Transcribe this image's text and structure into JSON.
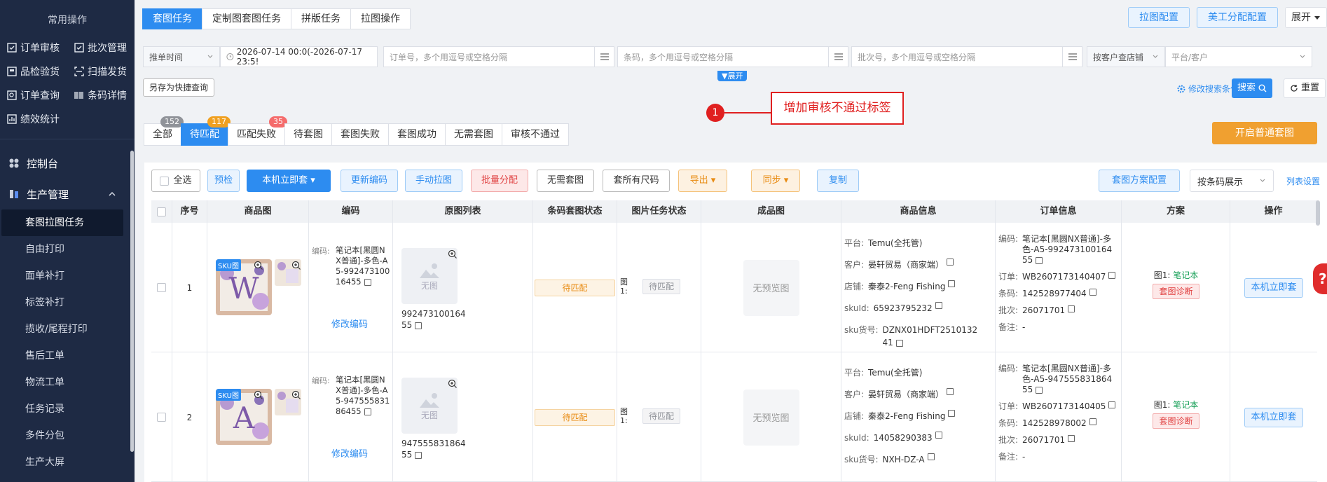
{
  "sidebar": {
    "header": "常用操作",
    "quick": [
      {
        "label": "订单审核",
        "icon": "check-square-icon"
      },
      {
        "label": "批次管理",
        "icon": "check-square-icon"
      },
      {
        "label": "品检验货",
        "icon": "box-icon"
      },
      {
        "label": "扫描发货",
        "icon": "scan-icon"
      },
      {
        "label": "订单查询",
        "icon": "search-box-icon"
      },
      {
        "label": "条码详情",
        "icon": "barcode-icon"
      }
    ],
    "quick_single": "绩效统计",
    "groups": [
      {
        "label": "控制台"
      },
      {
        "label": "生产管理"
      }
    ],
    "items": [
      "套图拉图任务",
      "自由打印",
      "面单补打",
      "标签补打",
      "揽收/尾程打印",
      "售后工单",
      "物流工单",
      "任务记录",
      "多件分包",
      "生产大屏"
    ]
  },
  "top_tabs": [
    "套图任务",
    "定制图套图任务",
    "拼版任务",
    "拉图操作"
  ],
  "top_right": {
    "pull_config": "拉图配置",
    "artist_config": "美工分配配置",
    "expand": "展开"
  },
  "filter": {
    "sort_select": "推单时间",
    "date_range": "2026-07-14 00:0(-2026-07-17 23:5!",
    "order_ph": "订单号，多个用逗号或空格分隔",
    "barcode_ph": "条码，多个用逗号或空格分隔",
    "batch_ph": "批次号，多个用逗号或空格分隔",
    "store_select": "按客户查店铺",
    "platform_ph": "平台/客户"
  },
  "quick_query": {
    "save": "另存为快捷查询",
    "expand": "展开",
    "modify": "修改搜索条件",
    "search": "搜索",
    "reset": "重置"
  },
  "status_tabs": [
    {
      "label": "全部",
      "badge": "152"
    },
    {
      "label": "待匹配",
      "badge": "117"
    },
    {
      "label": "匹配失败",
      "badge": "35"
    },
    {
      "label": "待套图"
    },
    {
      "label": "套图失败"
    },
    {
      "label": "套图成功"
    },
    {
      "label": "无需套图"
    },
    {
      "label": "审核不通过"
    }
  ],
  "annotation": {
    "number": "1",
    "text": "增加审核不通过标签"
  },
  "start_button": "开启普通套图",
  "toolbar": {
    "select_all": "全选",
    "precheck": "预检",
    "local_apply": "本机立即套",
    "update_code": "更新编码",
    "manual_pull": "手动拉图",
    "batch_assign": "批量分配",
    "no_need": "无需套图",
    "all_sizes": "套所有尺码",
    "export": "导出",
    "sync": "同步",
    "copy": "复制",
    "plan_config": "套图方案配置",
    "display_select": "按条码展示",
    "list_settings": "列表设置"
  },
  "columns": [
    "序号",
    "商品图",
    "编码",
    "原图列表",
    "条码套图状态",
    "图片任务状态",
    "成品图",
    "商品信息",
    "订单信息",
    "方案",
    "操作"
  ],
  "labels": {
    "code": "编码:",
    "modify_code": "修改编码",
    "no_image": "无图",
    "sku_tag": "SKU图",
    "img_prefix": "图1:",
    "no_preview": "无预览图",
    "platform": "平台:",
    "customer": "客户:",
    "store": "店铺:",
    "sku_id": "skuId:",
    "sku_no": "sku货号:",
    "ord_code": "编码:",
    "ord_order": "订单:",
    "ord_barcode": "条码:",
    "ord_batch": "批次:",
    "ord_remark": "备注:",
    "plan_prefix": "图1:",
    "diagnose": "套图诊断",
    "op_apply": "本机立即套"
  },
  "rows": [
    {
      "index": "1",
      "letter": "W",
      "code": "笔记本[黑圆NX普通]-多色-A5-99247310016455",
      "orig_code": "99247310016455",
      "barcode_status": "待匹配",
      "img_status": "待匹配",
      "platform": "Temu(全托管)",
      "customer": "晏轩贸易（商家端）",
      "store": "秦泰2-Feng Fishing",
      "sku_id": "65923795232",
      "sku_no": "DZNX01HDFT251013241",
      "ord_code": "笔记本[黑圆NX普通]-多色-A5-99247310016455",
      "ord_order": "WB2607173140407",
      "ord_barcode": "142528977404",
      "ord_batch": "26071701",
      "ord_remark": "-",
      "plan": "笔记本"
    },
    {
      "index": "2",
      "letter": "A",
      "code": "笔记本[黑圆NX普通]-多色-A5-94755583186455",
      "orig_code": "94755583186455",
      "barcode_status": "待匹配",
      "img_status": "待匹配",
      "platform": "Temu(全托管)",
      "customer": "晏轩贸易（商家端）",
      "store": "秦泰2-Feng Fishing",
      "sku_id": "14058290383",
      "sku_no": "NXH-DZ-A",
      "ord_code": "笔记本[黑圆NX普通]-多色-A5-94755583186455",
      "ord_order": "WB2607173140405",
      "ord_barcode": "142528978002",
      "ord_batch": "26071701",
      "ord_remark": "-",
      "plan": "笔记本"
    }
  ],
  "side_help": "?",
  "colors": {
    "primary": "#2d8cf0",
    "sidebar": "#1e2a44",
    "annotation": "#e02020",
    "warning": "#f0a030"
  }
}
